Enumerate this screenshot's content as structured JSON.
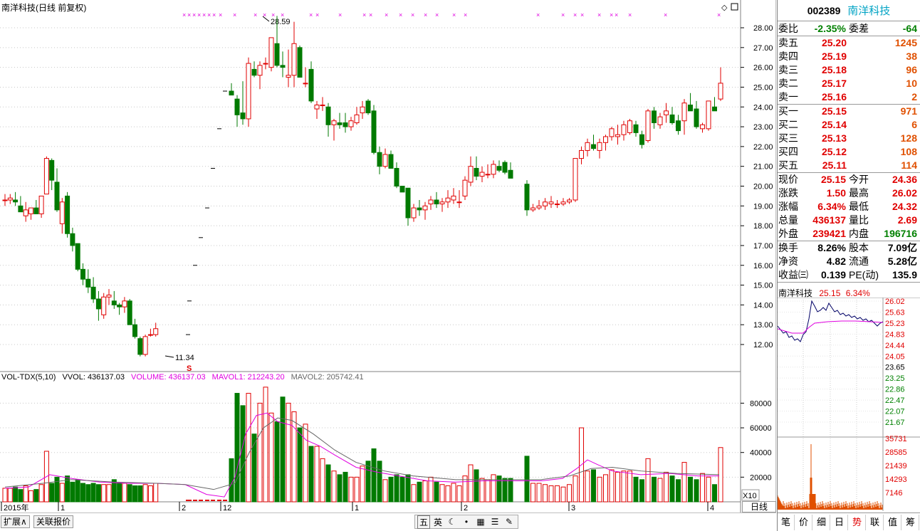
{
  "panel_title": "南洋科技(日线 前复权)",
  "colors": {
    "up": "#e00000",
    "down": "#007a00",
    "ma1": "#e000e0",
    "ma2": "#666666",
    "grid": "#c8c8c8",
    "mini_line": "#000066",
    "mini_avg": "#e000e0",
    "mini_vol": "#e05000"
  },
  "main_chart": {
    "price_ticks": [
      "28.00",
      "27.00",
      "26.00",
      "25.00",
      "24.00",
      "23.00",
      "22.00",
      "21.00",
      "20.00",
      "19.00",
      "18.00",
      "17.00",
      "16.00",
      "15.00",
      "14.00",
      "13.00",
      "12.00"
    ],
    "high_label": "28.59",
    "low_label": "11.34",
    "marker_label": "S",
    "diamond_icons": [
      "◇",
      "□"
    ]
  },
  "volume_panel": {
    "legend": [
      {
        "text": "VOL-TDX(5,10)",
        "color": "#000000"
      },
      {
        "text": "VVOL: 436137.03",
        "color": "#000000"
      },
      {
        "text": "VOLUME: 436137.03",
        "color": "#e000e0"
      },
      {
        "text": "MAVOL1: 212243.20",
        "color": "#e000e0"
      },
      {
        "text": "MAVOL2: 205742.41",
        "color": "#666666"
      }
    ],
    "ticks": [
      "80000",
      "60000",
      "40000",
      "20000"
    ],
    "scale_label": "X10"
  },
  "date_axis": {
    "labels": [
      "2015年",
      "1",
      "2",
      "12",
      "1",
      "2",
      "3",
      "4"
    ],
    "period": "日线"
  },
  "bottom_bar": {
    "expand_label": "扩展∧",
    "related_label": "关联报价",
    "tool_icons": [
      "五",
      "英",
      "moon",
      "person",
      "keyboard",
      "menu",
      "wrench"
    ]
  },
  "quote": {
    "code": "002389",
    "name": "南洋科技",
    "wei_bi_label": "委比",
    "wei_bi": "-2.35%",
    "wei_cha_label": "委差",
    "wei_cha": "-64",
    "asks": [
      {
        "label": "卖五",
        "price": "25.20",
        "vol": "1245"
      },
      {
        "label": "卖四",
        "price": "25.19",
        "vol": "38"
      },
      {
        "label": "卖三",
        "price": "25.18",
        "vol": "96"
      },
      {
        "label": "卖二",
        "price": "25.17",
        "vol": "10"
      },
      {
        "label": "卖一",
        "price": "25.16",
        "vol": "2"
      }
    ],
    "bids": [
      {
        "label": "买一",
        "price": "25.15",
        "vol": "971"
      },
      {
        "label": "买二",
        "price": "25.14",
        "vol": "6"
      },
      {
        "label": "买三",
        "price": "25.13",
        "vol": "128"
      },
      {
        "label": "买四",
        "price": "25.12",
        "vol": "108"
      },
      {
        "label": "买五",
        "price": "25.11",
        "vol": "114"
      }
    ],
    "stats": [
      {
        "l1": "现价",
        "v1": "25.15",
        "c1": "red",
        "l2": "今开",
        "v2": "24.36",
        "c2": "red"
      },
      {
        "l1": "涨跌",
        "v1": "1.50",
        "c1": "red",
        "l2": "最高",
        "v2": "26.02",
        "c2": "red"
      },
      {
        "l1": "涨幅",
        "v1": "6.34%",
        "c1": "red",
        "l2": "最低",
        "v2": "24.32",
        "c2": "red"
      },
      {
        "l1": "总量",
        "v1": "436137",
        "c1": "red",
        "l2": "量比",
        "v2": "2.69",
        "c2": "red"
      },
      {
        "l1": "外盘",
        "v1": "239421",
        "c1": "red",
        "l2": "内盘",
        "v2": "196716",
        "c2": "green"
      }
    ],
    "fund": [
      {
        "l1": "换手",
        "v1": "8.26%",
        "l2": "股本",
        "v2": "7.09亿"
      },
      {
        "l1": "净资",
        "v1": "4.82",
        "l2": "流通",
        "v2": "5.28亿"
      },
      {
        "l1": "收益㈢",
        "v1": "0.139",
        "l2": "PE(动)",
        "v2": "135.9"
      }
    ]
  },
  "mini_chart": {
    "title_name": "南洋科技",
    "title_price": "25.15",
    "title_pct": "6.34%",
    "price_ticks": [
      "26.02",
      "25.63",
      "25.23",
      "24.83",
      "24.44",
      "24.05",
      "23.65",
      "23.25",
      "22.86",
      "22.47",
      "22.07",
      "21.67"
    ],
    "vol_ticks": [
      "35731",
      "28585",
      "21439",
      "14293",
      "7146"
    ]
  },
  "right_tabs": [
    "笔",
    "价",
    "细",
    "日",
    "势",
    "联",
    "值",
    "筹"
  ]
}
